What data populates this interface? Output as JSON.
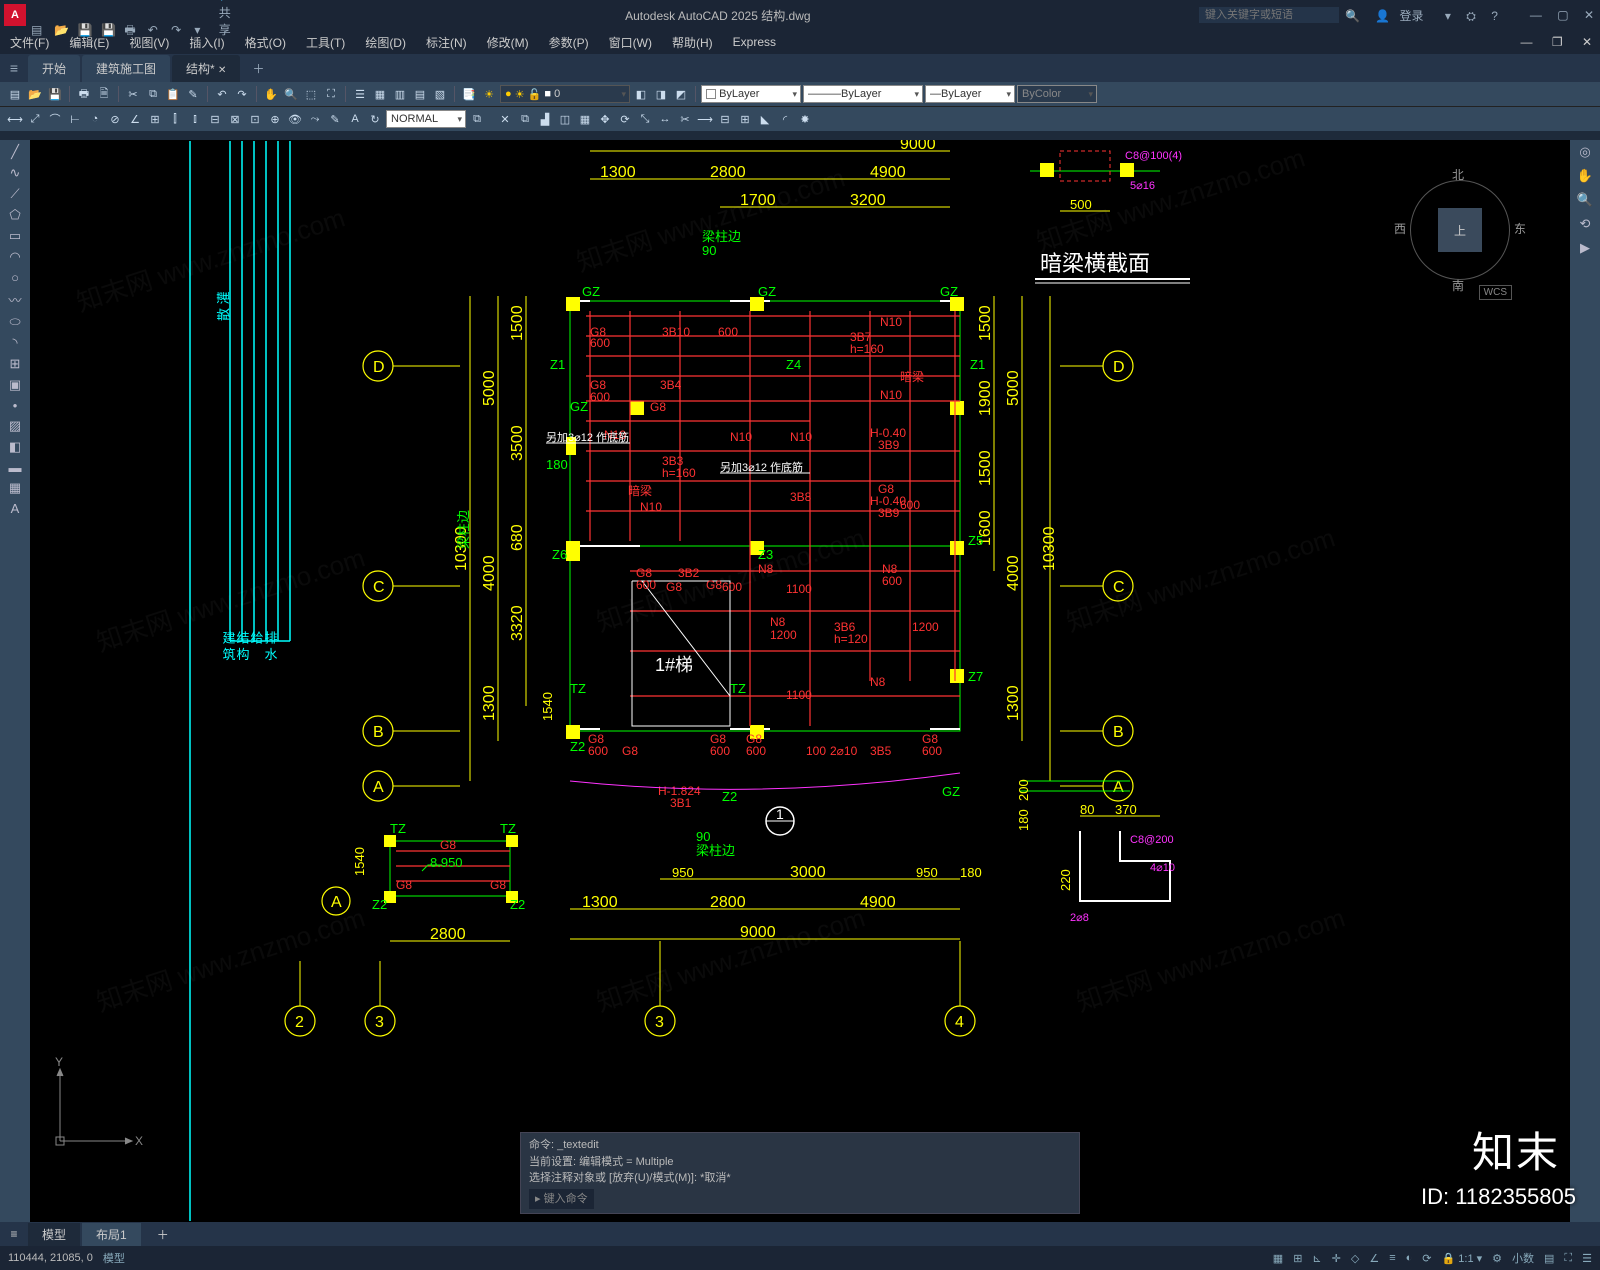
{
  "app": {
    "logo": "A",
    "title": "Autodesk AutoCAD 2025   结构.dwg",
    "share": "共享",
    "search_ph": "键入关键字或短语",
    "login": "登录"
  },
  "menus": [
    "文件(F)",
    "编辑(E)",
    "视图(V)",
    "插入(I)",
    "格式(O)",
    "工具(T)",
    "绘图(D)",
    "标注(N)",
    "修改(M)",
    "参数(P)",
    "窗口(W)",
    "帮助(H)",
    "Express"
  ],
  "tabs": {
    "items": [
      "开始",
      "建筑施工图",
      "结构*"
    ],
    "active": 2
  },
  "ribbon": {
    "layer_num": "0",
    "bylayer": "ByLayer",
    "linetype": "ByLayer",
    "lineweight": "ByLayer",
    "bycolor": "ByColor",
    "dimstyle": "NORMAL"
  },
  "viewcube": {
    "top": "上",
    "n": "北",
    "s": "南",
    "e": "东",
    "w": "西",
    "wcs": "WCS"
  },
  "drawing": {
    "section_title": "暗梁横截面",
    "stair": "1#梯",
    "section_tag": "1",
    "grid_letters": [
      "A",
      "B",
      "C",
      "D"
    ],
    "grid_nums": [
      "2",
      "3",
      "4"
    ],
    "cols": {
      "GZ": "GZ",
      "Z1": "Z1",
      "Z2": "Z2",
      "Z3": "Z3",
      "Z4": "Z4",
      "Z5": "Z5",
      "Z6": "Z6",
      "Z7": "Z7",
      "TZ": "TZ"
    },
    "dims_h": {
      "d9000": "9000",
      "d1300": "1300",
      "d2800": "2800",
      "d4900": "4900",
      "d1700": "1700",
      "d3200": "3200",
      "d500": "500",
      "d950": "950",
      "d3000": "3000",
      "d180": "180",
      "d80": "80",
      "d370": "370"
    },
    "dims_v": {
      "d10300": "10300",
      "d5000": "5000",
      "d4000": "4000",
      "d1300": "1300",
      "d1500": "1500",
      "d3500": "3500",
      "d680": "680",
      "d3320": "3320",
      "d1540": "1540",
      "d1900": "1900",
      "d1600": "1600",
      "d200": "200",
      "d180": "180",
      "d220": "220"
    },
    "beams": {
      "G8": "G8",
      "N8": "N8",
      "N10": "N10",
      "3B1": "3B1",
      "3B2": "3B2",
      "3B3": "3B3",
      "3B4": "3B4",
      "3B5": "3B5",
      "3B6": "3B6",
      "3B7": "3B7",
      "3B8": "3B8",
      "3B9": "3B9",
      "3B10": "3B10",
      "h160": "h=160",
      "h120": "h=120"
    },
    "notes": {
      "liangzhubian": "梁柱边",
      "anliang": "暗梁",
      "d90": "90",
      "d600": "600",
      "d1200": "1200",
      "d1100": "1100",
      "H040": "H-0.40",
      "H1824": "H-1.824",
      "jia": "另加3⌀12 作底筋",
      "val8950": "8.950",
      "c8200": "C8@200",
      "c80104": "C8@100(4)",
      "d5116": "5⌀16",
      "d4110": "4⌀10",
      "d218": "2⌀8",
      "d100": "100",
      "d2110": "2⌀10"
    }
  },
  "cmd": {
    "l1": "命令:  _textedit",
    "l2": "当前设置: 编辑模式 = Multiple",
    "l3": "选择注释对象或 [放弃(U)/模式(M)]: *取消*",
    "prompt": "▸  键入命令"
  },
  "btabs": {
    "items": [
      "模型",
      "布局1"
    ],
    "active": 0
  },
  "status": {
    "coords": "110444, 21085, 0",
    "model": "模型",
    "scale": "1:1",
    "dec": "小数"
  },
  "watermark": {
    "text": "知末网 www.znzmo.com",
    "brand": "知末",
    "id": "ID: 1182355805"
  }
}
